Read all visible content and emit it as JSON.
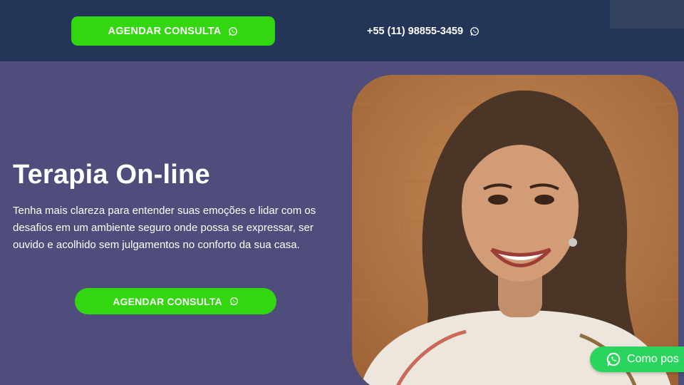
{
  "header": {
    "cta_label": "AGENDAR CONSULTA",
    "cta_icon": "whatsapp-icon",
    "phone": "+55 (11) 98855-3459",
    "phone_icon": "whatsapp-icon"
  },
  "hero": {
    "title": "Terapia On-line",
    "description": "Tenha mais clareza para entender suas emoções e lidar com os desafios em um ambiente seguro onde possa se expressar, ser ouvido e acolhido sem julgamentos no conforto da sua casa.",
    "cta_label": "AGENDAR CONSULTA",
    "cta_icon": "whatsapp-icon"
  },
  "chat_widget": {
    "label": "Como pos",
    "icon": "whatsapp-icon"
  },
  "colors": {
    "header_bg": "#243657",
    "hero_bg": "#4e4d7b",
    "cta_green": "#33d70f",
    "whatsapp_green": "#2bd45e"
  }
}
